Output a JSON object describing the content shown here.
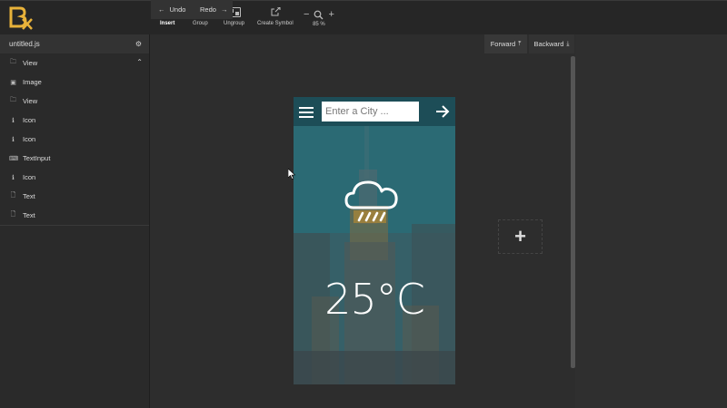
{
  "toolbar": {
    "insert": "Insert",
    "group": "Group",
    "ungroup": "Ungroup",
    "create_symbol": "Create Symbol",
    "zoom": "85 %"
  },
  "left_panel": {
    "filename": "untitled.js",
    "items": [
      {
        "label": "View",
        "icon": "folder-icon"
      },
      {
        "label": "Image",
        "icon": "image-icon"
      },
      {
        "label": "View",
        "icon": "folder-icon"
      },
      {
        "label": "Icon",
        "icon": "info-icon"
      },
      {
        "label": "Icon",
        "icon": "info-icon"
      },
      {
        "label": "TextInput",
        "icon": "keyboard-icon"
      },
      {
        "label": "Icon",
        "icon": "info-icon"
      },
      {
        "label": "Text",
        "icon": "document-icon"
      },
      {
        "label": "Text",
        "icon": "document-icon"
      }
    ]
  },
  "history": {
    "undo": "Undo",
    "redo": "Redo"
  },
  "arrange": {
    "forward": "Forward",
    "backward": "Backward"
  },
  "preview": {
    "city_placeholder": "Enter a City ...",
    "temperature": "25°C"
  },
  "canvas": {
    "add_label": "+"
  },
  "colors": {
    "accent": "#e8b23a",
    "header": "#1d4d57"
  }
}
